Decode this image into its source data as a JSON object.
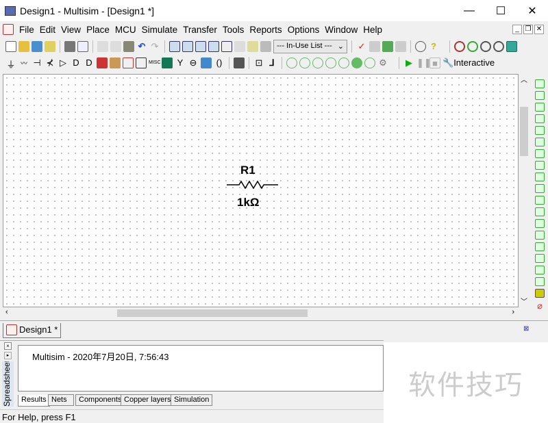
{
  "window": {
    "title": "Design1 - Multisim - [Design1 *]",
    "minimize": "—",
    "maximize": "☐",
    "close": "✕"
  },
  "menu": [
    "File",
    "Edit",
    "View",
    "Place",
    "MCU",
    "Simulate",
    "Transfer",
    "Tools",
    "Reports",
    "Options",
    "Window",
    "Help"
  ],
  "toolbar": {
    "in_use_list": "--- In-Use List ---",
    "interactive": "Interactive"
  },
  "schematic": {
    "ref": "R1",
    "value": "1kΩ"
  },
  "design_tab": "Design1 *",
  "spreadsheet": {
    "side_label": "Spreadsheet",
    "log": "Multisim  -  2020年7月20日, 7:56:43",
    "tabs": [
      "Results",
      "Nets",
      "Components",
      "Copper layers",
      "Simulation"
    ]
  },
  "status": "For Help, press F1",
  "watermark": "软件技巧"
}
